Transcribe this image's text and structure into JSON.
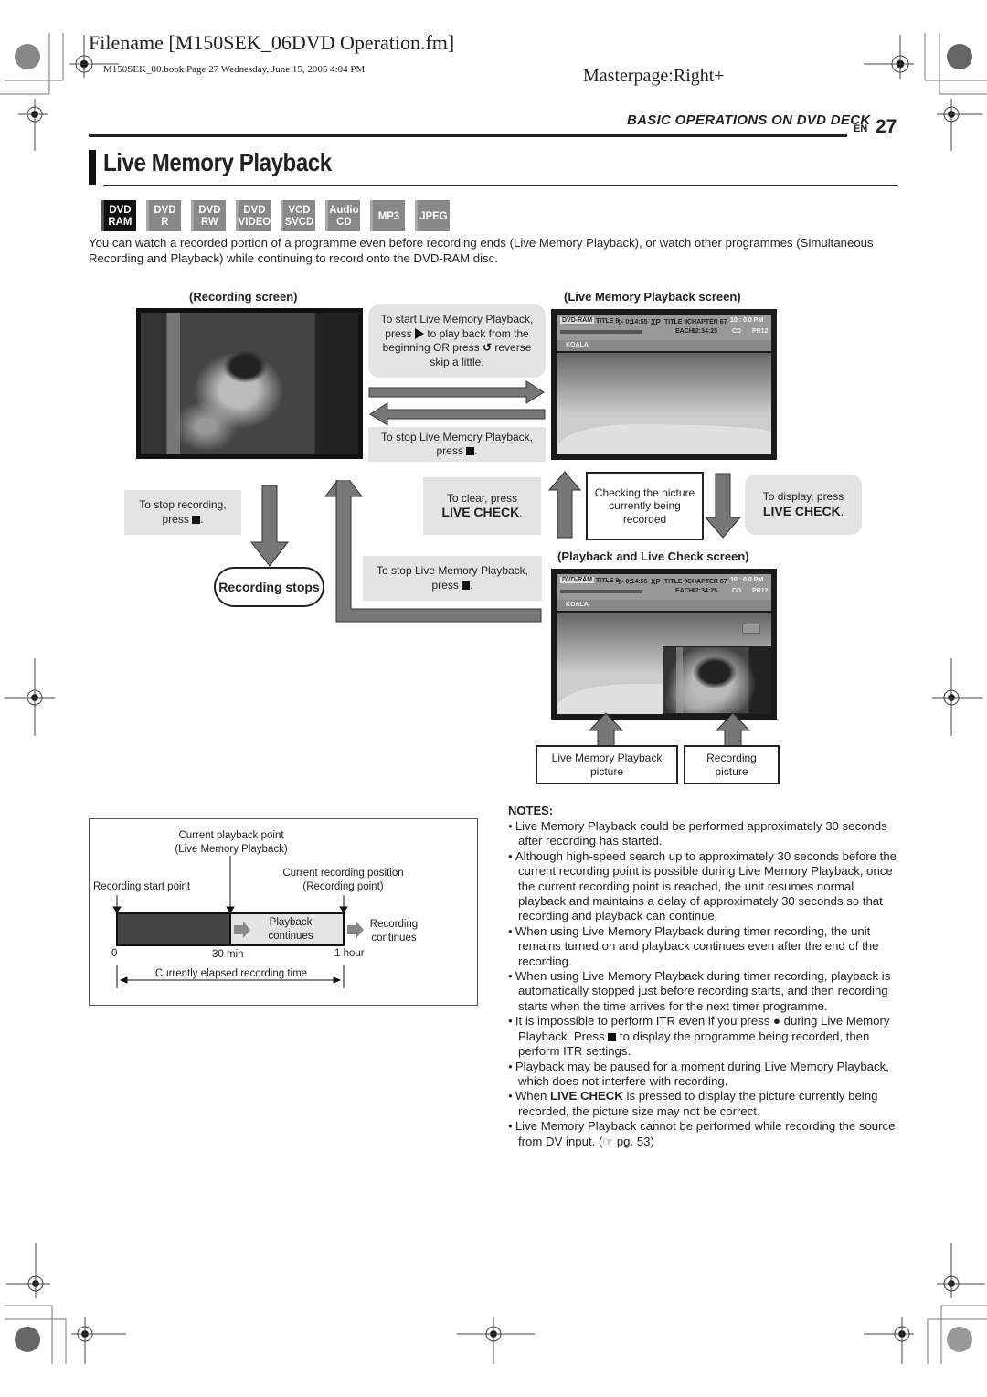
{
  "header": {
    "filename": "Filename [M150SEK_06DVD Operation.fm]",
    "book_line": "M150SEK_00.book  Page 27  Wednesday, June 15, 2005  4:04 PM",
    "masterpage": "Masterpage:Right+",
    "section": "BASIC OPERATIONS ON DVD DECK",
    "lang": "EN",
    "page_number": "27"
  },
  "title": "Live Memory Playback",
  "discs": [
    {
      "label": "DVD\nRAM",
      "active": true
    },
    {
      "label": "DVD\nR",
      "active": false
    },
    {
      "label": "DVD\nRW",
      "active": false
    },
    {
      "label": "DVD\nVIDEO",
      "active": false
    },
    {
      "label": "VCD\nSVCD",
      "active": false
    },
    {
      "label": "Audio\nCD",
      "active": false
    },
    {
      "label": "MP3",
      "active": false
    },
    {
      "label": "JPEG",
      "active": false
    }
  ],
  "intro": "You can watch a recorded portion of a programme even before recording ends (Live Memory Playback), or watch other programmes (Simultaneous Recording and Playback) while continuing to record onto the DVD-RAM disc.",
  "diagram": {
    "recording_screen_caption": "(Recording screen)",
    "lmp_screen_caption": "(Live Memory Playback screen)",
    "plc_screen_caption": "(Playback and Live Check screen)",
    "start_note": {
      "line1": "To start Live Memory Playback,",
      "line2a": "press",
      "line2b": "to play back from the",
      "line3a": "beginning OR press",
      "line3b": "reverse",
      "line4": "skip a little."
    },
    "stop_lmp_note_1": {
      "line1": "To stop Live Memory Playback,",
      "line2": "press"
    },
    "stop_recording_note": {
      "line1": "To stop recording,",
      "line2": "press"
    },
    "recording_stops": "Recording stops",
    "clear_note": {
      "line1": "To clear, press",
      "button": "LIVE CHECK"
    },
    "checking_box": "Checking the picture\ncurrently being\nrecorded",
    "display_note": {
      "line1": "To display, press",
      "button": "LIVE CHECK"
    },
    "stop_lmp_note_2": {
      "line1": "To stop Live Memory Playback,",
      "line2": "press"
    },
    "lmp_picture_label": "Live Memory Playback\npicture",
    "recording_picture_label": "Recording\npicture",
    "osd": {
      "disc": "DVD-RAM",
      "title_label": "TITLE 9",
      "elapsed": "▷ 0:14:55",
      "mode": "XP",
      "title2": "TITLE 9",
      "chapter": "CHAPTER 67",
      "each": "EACH",
      "time2": "12:34:25",
      "clock": "10 : 0 0 PM",
      "input": "CD",
      "channel": "PR12",
      "program": "KOALA"
    }
  },
  "timeline": {
    "playback_point": "Current playback point\n(Live Memory Playback)",
    "recording_position": "Current recording position\n(Recording point)",
    "start_point": "Recording start point",
    "playback_continues": "Playback\ncontinues",
    "recording_continues": "Recording\ncontinues",
    "tick_0": "0",
    "tick_30": "30 min",
    "tick_1h": "1 hour",
    "elapsed_label": "Currently elapsed recording time"
  },
  "notes": {
    "title": "NOTES:",
    "items": [
      "Live Memory Playback could be performed approximately 30 seconds after recording has started.",
      "Although high-speed search up to approximately 30 seconds before the current recording point is possible during Live Memory Playback, once the current recording point is reached, the unit resumes normal playback and maintains a delay of approximately 30 seconds so that recording and playback can continue.",
      "When using Live Memory Playback during timer recording, the unit remains turned on and playback continues even after the end of the recording.",
      "When using Live Memory Playback during timer recording, playback is automatically stopped just before recording starts, and then recording starts when the time arrives for the next timer programme."
    ],
    "itr_note": {
      "a": "It is impossible to perform ITR even if you press",
      "b": "during Live Memory Playback. Press",
      "c": "to display the programme being recorded, then perform ITR settings."
    },
    "pause_note": "Playback may be paused for a moment during Live Memory Playback, which does not interfere with recording.",
    "livecheck_note": {
      "a": "When",
      "bold": "LIVE CHECK",
      "b": "is pressed to display the picture currently being recorded, the picture size may not be correct."
    },
    "dv_note": "Live Memory Playback cannot be performed while recording the source from DV input. (☞ pg. 53)"
  }
}
